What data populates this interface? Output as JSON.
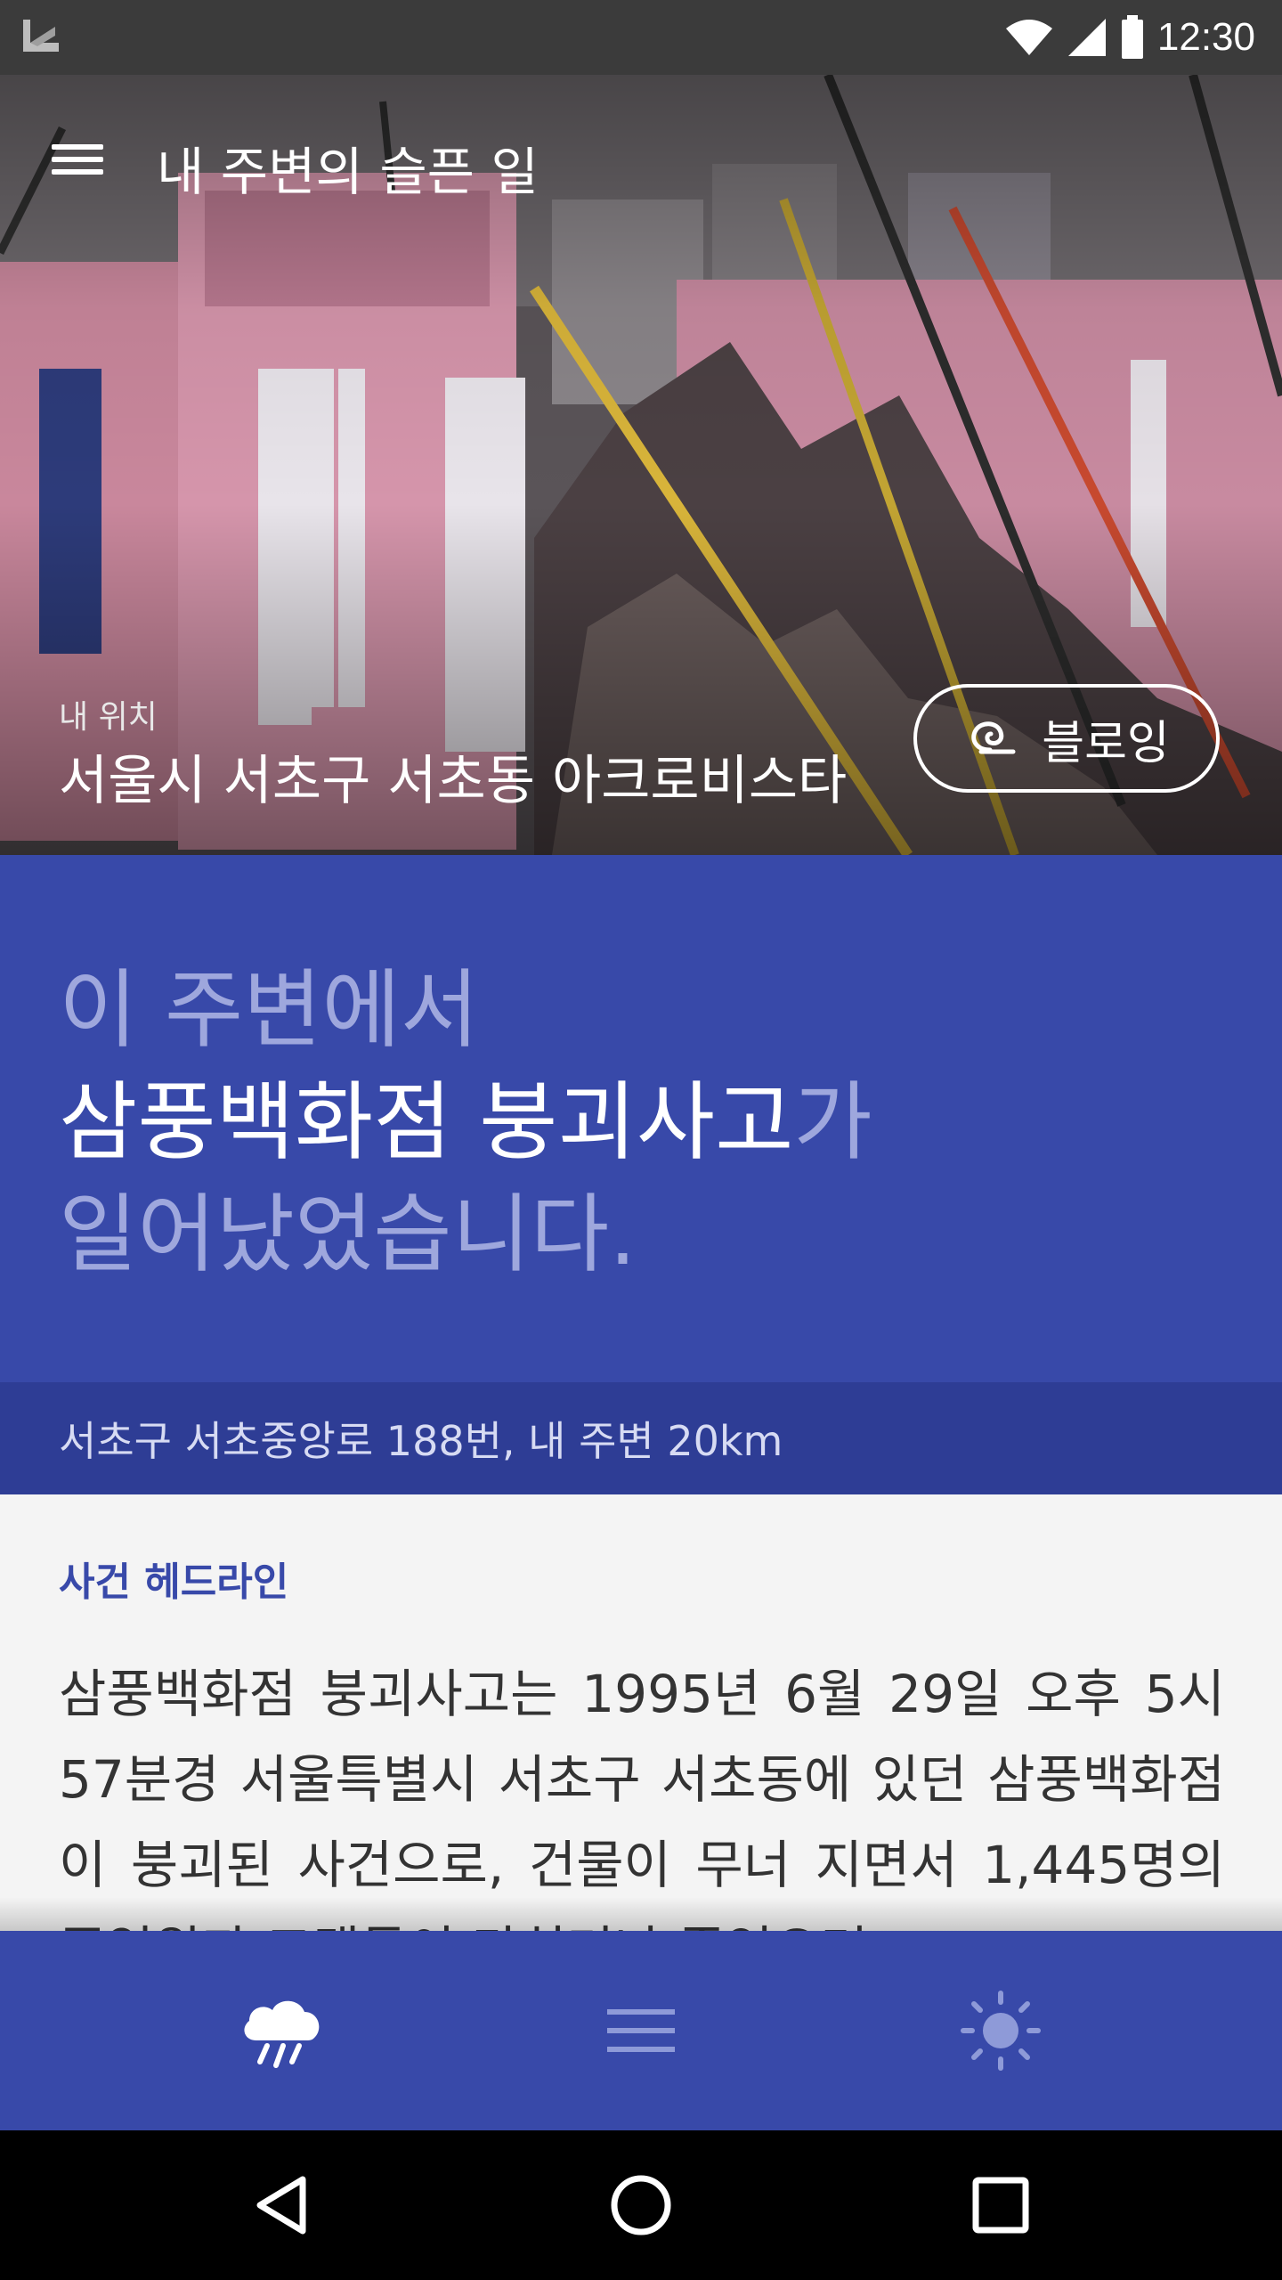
{
  "status_bar": {
    "time": "12:30",
    "icons": [
      "app-logo-icon",
      "wifi-icon",
      "signal-icon",
      "battery-icon"
    ]
  },
  "app_bar": {
    "title": "내 주변의 슬픈 일",
    "menu_icon": "hamburger-menu-icon"
  },
  "location": {
    "label": "내 위치",
    "value": "서울시 서초구 서초동 아크로비스타"
  },
  "blowing_button": {
    "label": "블로잉",
    "icon": "swirl-icon"
  },
  "headline": {
    "line1": "이 주변에서",
    "line2_highlight": "삼풍백화점 붕괴사고",
    "line2_suffix": "가",
    "line3": "일어났었습니다."
  },
  "address": "서초구 서초중앙로 188번, 내 주변 20km",
  "article": {
    "section_title": "사건 헤드라인",
    "body": "삼풍백화점 붕괴사고는 1995년 6월 29일 오후 5시 57분경 서울특별시 서초구 서초동에 있던 삼풍백화점이 붕괴된 사건으로, 건물이 무너 지면서 1,445명의 종업원과 고객들이 다치거나 죽었으며"
  },
  "bottom_nav": [
    {
      "name": "weather-tab",
      "icon": "rain-cloud-icon"
    },
    {
      "name": "list-tab",
      "icon": "list-icon"
    },
    {
      "name": "settings-tab",
      "icon": "sun-icon"
    }
  ],
  "system_nav": [
    "back-icon",
    "home-icon",
    "recents-icon"
  ],
  "colors": {
    "primary": "#3849a9",
    "primary_dark": "#2e3d95",
    "headline_dim": "#9ea7dd",
    "status_bar": "#3b3b3b"
  }
}
